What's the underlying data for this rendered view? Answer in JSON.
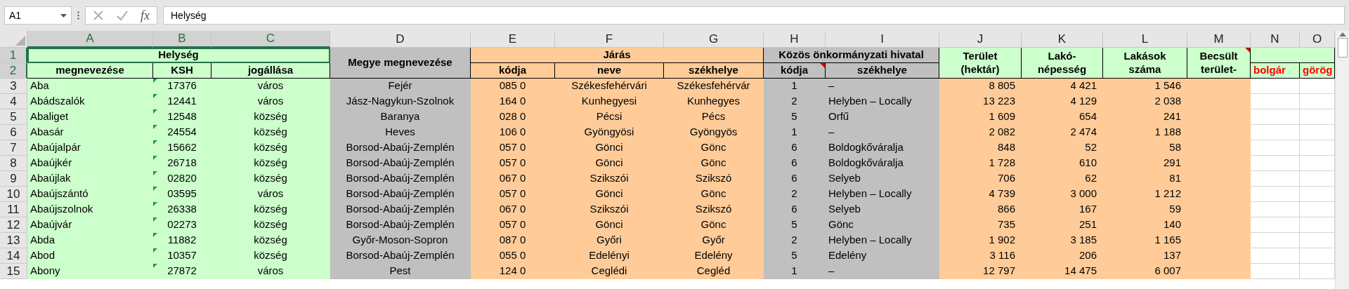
{
  "formula_bar": {
    "name_box": "A1",
    "function_label": "fx",
    "value": "Helység"
  },
  "columns": [
    {
      "label": "A",
      "selected": true
    },
    {
      "label": "B",
      "selected": true
    },
    {
      "label": "C",
      "selected": true
    },
    {
      "label": "D",
      "selected": false
    },
    {
      "label": "E",
      "selected": false
    },
    {
      "label": "F",
      "selected": false
    },
    {
      "label": "G",
      "selected": false
    },
    {
      "label": "H",
      "selected": false
    },
    {
      "label": "I",
      "selected": false
    },
    {
      "label": "J",
      "selected": false
    },
    {
      "label": "K",
      "selected": false
    },
    {
      "label": "L",
      "selected": false
    },
    {
      "label": "M",
      "selected": false
    },
    {
      "label": "N",
      "selected": false
    },
    {
      "label": "O",
      "selected": false
    }
  ],
  "header": {
    "helyseg": {
      "title": "Helység",
      "selected": true,
      "sub": [
        "megnevezése",
        "KSH",
        "jogállása"
      ]
    },
    "megye": "Megye megnevezése",
    "jaras": {
      "title": "Járás",
      "sub": [
        "kódja",
        "neve",
        "székhelye"
      ]
    },
    "hivatal": {
      "title": "Közös önkormányzati hivatal",
      "sub": [
        "kódja",
        "székhelye"
      ],
      "note_on_code": true
    },
    "terulet": [
      "Terület",
      "(hektár)"
    ],
    "lakonepesseg": [
      "Lakó-",
      "népesség"
    ],
    "lakasok": [
      "Lakások",
      "száma"
    ],
    "becsult": {
      "lines": [
        "Becsült",
        "terület-"
      ],
      "note": true
    },
    "extra_sub": [
      "bolgár",
      "görög"
    ]
  },
  "rows": [
    {
      "num": "1",
      "selected": true
    },
    {
      "num": "2",
      "selected": true
    },
    {
      "num": "3",
      "selected": false,
      "marker": true,
      "cells": [
        "Aba",
        "17376",
        "város",
        "Fejér",
        "085 0",
        "Székesfehérvári",
        "Székesfehérvár",
        "1",
        "–",
        "8 805",
        "4 421",
        "1 546"
      ]
    },
    {
      "num": "4",
      "selected": false,
      "marker": true,
      "cells": [
        "Abádszalók",
        "12441",
        "város",
        "Jász-Nagykun-Szolnok",
        "164 0",
        "Kunhegyesi",
        "Kunhegyes",
        "2",
        "Helyben – Locally",
        "13 223",
        "4 129",
        "2 038"
      ]
    },
    {
      "num": "5",
      "selected": false,
      "marker": true,
      "cells": [
        "Abaliget",
        "12548",
        "község",
        "Baranya",
        "028 0",
        "Pécsi",
        "Pécs",
        "5",
        "Orfű",
        "1 609",
        "654",
        "241"
      ]
    },
    {
      "num": "6",
      "selected": false,
      "marker": true,
      "cells": [
        "Abasár",
        "24554",
        "község",
        "Heves",
        "106 0",
        "Gyöngyösi",
        "Gyöngyös",
        "1",
        "–",
        "2 082",
        "2 474",
        "1 188"
      ]
    },
    {
      "num": "7",
      "selected": false,
      "marker": true,
      "cells": [
        "Abaújalpár",
        "15662",
        "község",
        "Borsod-Abaúj-Zemplén",
        "057 0",
        "Gönci",
        "Gönc",
        "6",
        "Boldogkőváralja",
        "848",
        "52",
        "58"
      ]
    },
    {
      "num": "8",
      "selected": false,
      "marker": true,
      "cells": [
        "Abaújkér",
        "26718",
        "község",
        "Borsod-Abaúj-Zemplén",
        "057 0",
        "Gönci",
        "Gönc",
        "6",
        "Boldogkőváralja",
        "1 728",
        "610",
        "291"
      ]
    },
    {
      "num": "9",
      "selected": false,
      "marker": true,
      "cells": [
        "Abaújlak",
        "02820",
        "község",
        "Borsod-Abaúj-Zemplén",
        "067 0",
        "Szikszói",
        "Szikszó",
        "6",
        "Selyeb",
        "706",
        "62",
        "81"
      ]
    },
    {
      "num": "10",
      "selected": false,
      "marker": true,
      "cells": [
        "Abaújszántó",
        "03595",
        "város",
        "Borsod-Abaúj-Zemplén",
        "057 0",
        "Gönci",
        "Gönc",
        "2",
        "Helyben – Locally",
        "4 739",
        "3 000",
        "1 212"
      ]
    },
    {
      "num": "11",
      "selected": false,
      "marker": true,
      "cells": [
        "Abaújszolnok",
        "26338",
        "község",
        "Borsod-Abaúj-Zemplén",
        "067 0",
        "Szikszói",
        "Szikszó",
        "6",
        "Selyeb",
        "866",
        "167",
        "59"
      ]
    },
    {
      "num": "12",
      "selected": false,
      "marker": true,
      "cells": [
        "Abaújvár",
        "02273",
        "község",
        "Borsod-Abaúj-Zemplén",
        "057 0",
        "Gönci",
        "Gönc",
        "5",
        "Gönc",
        "735",
        "251",
        "140"
      ]
    },
    {
      "num": "13",
      "selected": false,
      "marker": true,
      "cells": [
        "Abda",
        "11882",
        "község",
        "Győr-Moson-Sopron",
        "087 0",
        "Győri",
        "Győr",
        "2",
        "Helyben – Locally",
        "1 902",
        "3 185",
        "1 165"
      ]
    },
    {
      "num": "14",
      "selected": false,
      "marker": true,
      "cells": [
        "Abod",
        "10357",
        "község",
        "Borsod-Abaúj-Zemplén",
        "055 0",
        "Edelényi",
        "Edelény",
        "5",
        "Edelény",
        "3 116",
        "206",
        "137"
      ]
    },
    {
      "num": "15",
      "selected": false,
      "marker": true,
      "cells": [
        "Abony",
        "27872",
        "város",
        "Pest",
        "124 0",
        "Ceglédi",
        "Cegléd",
        "1",
        "–",
        "12 797",
        "14 475",
        "6 007"
      ]
    }
  ]
}
